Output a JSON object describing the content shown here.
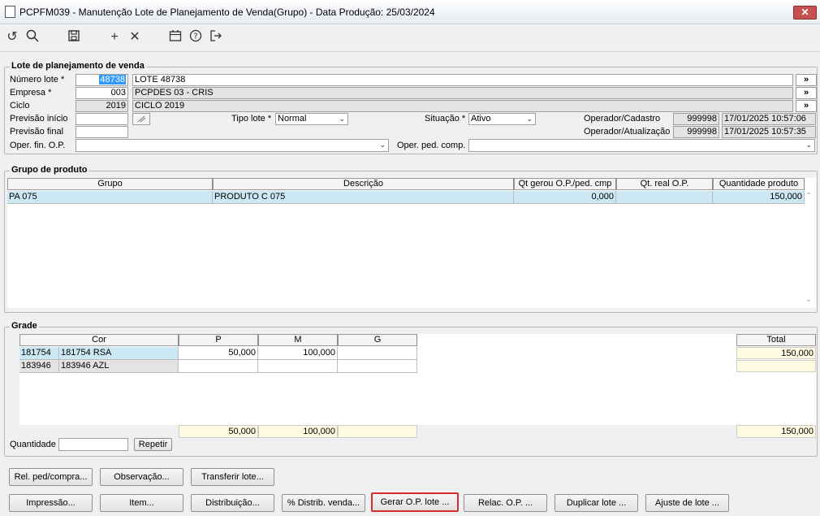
{
  "window": {
    "title": "PCPFM039 - Manutenção Lote de Planejamento de Venda(Grupo) - Data Produção: 25/03/2024",
    "close_label": "✕"
  },
  "toolbar": {
    "undo": "↺",
    "search": "🔍",
    "save": "💾",
    "add": "+",
    "delete": "✕",
    "calendar": "📅",
    "help": "?",
    "exit": "⇥"
  },
  "lote": {
    "legend": "Lote de planejamento de venda",
    "numero_label": "Número lote *",
    "numero_value": "48738",
    "numero_desc": "LOTE 48738",
    "empresa_label": "Empresa *",
    "empresa_value": "003",
    "empresa_desc": "PCPDES 03 - CRIS",
    "ciclo_label": "Ciclo",
    "ciclo_value": "2019",
    "ciclo_desc": "CICLO 2019",
    "prev_inicio_label": "Previsão início",
    "prev_final_label": "Previsão final",
    "oper_fin_label": "Oper. fin. O.P.",
    "tipo_label": "Tipo lote *",
    "tipo_value": "Normal",
    "situacao_label": "Situação *",
    "situacao_value": "Ativo",
    "op_cad_label": "Operador/Cadastro",
    "op_cad_code": "999998",
    "op_cad_date": "17/01/2025 10:57:06",
    "op_atu_label": "Operador/Atualização",
    "op_atu_code": "999998",
    "op_atu_date": "17/01/2025 10:57:35",
    "oper_ped_label": "Oper. ped. comp.",
    "more": "»"
  },
  "grupo": {
    "legend": "Grupo de produto",
    "headers": [
      "Grupo",
      "Descrição",
      "Qt gerou O.P./ped. cmp",
      "Qt. real O.P.",
      "Quantidade produto"
    ],
    "rows": [
      {
        "grupo": "PA 075",
        "descricao": "PRODUTO C 075",
        "qt_gerou": "0,000",
        "qt_real": "",
        "qt_produto": "150,000"
      }
    ]
  },
  "grade": {
    "legend": "Grade",
    "headers": [
      "Cor",
      "P",
      "M",
      "G",
      "Total"
    ],
    "rows": [
      {
        "code": "181754",
        "name": "181754 RSA",
        "p": "50,000",
        "m": "100,000",
        "g": "",
        "total": "150,000"
      },
      {
        "code": "183946",
        "name": "183946 AZL",
        "p": "",
        "m": "",
        "g": "",
        "total": ""
      }
    ],
    "totals": {
      "p": "50,000",
      "m": "100,000",
      "g": "",
      "total": "150,000"
    },
    "quantidade_label": "Quantidade",
    "repetir_label": "Repetir"
  },
  "buttons": {
    "rel_ped": "Rel. ped/compra...",
    "observacao": "Observação...",
    "transferir": "Transferir lote...",
    "impressao": "Impressão...",
    "item": "Item...",
    "distribuicao": "Distribuição...",
    "distrib_venda": "% Distrib. venda...",
    "gerar_op": "Gerar O.P.  lote ...",
    "relac_op": "Relac. O.P. ...",
    "duplicar": "Duplicar lote ...",
    "ajuste": "Ajuste de lote ..."
  }
}
